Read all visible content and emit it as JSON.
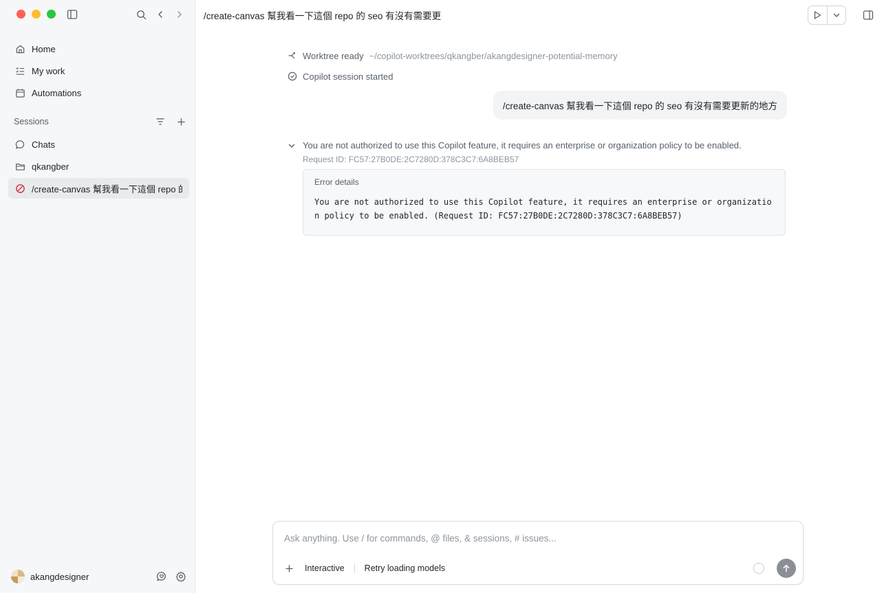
{
  "window": {
    "title": "/create-canvas 幫我看一下這個 repo 的 seo 有沒有需要更"
  },
  "sidebar": {
    "nav": [
      {
        "label": "Home",
        "icon": "home-icon"
      },
      {
        "label": "My work",
        "icon": "checklist-icon"
      },
      {
        "label": "Automations",
        "icon": "calendar-icon"
      }
    ],
    "sessions_label": "Sessions",
    "sessions": [
      {
        "label": "Chats",
        "icon": "chat-bubble-icon"
      },
      {
        "label": "qkangber",
        "icon": "folder-icon"
      },
      {
        "label": "/create-canvas 幫我看一下這個 repo 的 seo",
        "icon": "error-circle-icon",
        "active": true
      }
    ],
    "user": {
      "name": "akangdesigner"
    }
  },
  "events": {
    "worktree_label": "Worktree ready",
    "worktree_path": "~/copilot-worktrees/qkangber/akangdesigner-potential-memory",
    "session_started": "Copilot session started"
  },
  "user_message": "/create-canvas 幫我看一下這個 repo 的 seo 有沒有需要更新的地方",
  "error": {
    "summary": "You are not authorized to use this Copilot feature, it requires an enterprise or organization policy to be enabled.",
    "request_id": "Request ID: FC57:27B0DE:2C7280D:378C3C7:6A8BEB57",
    "details_title": "Error details",
    "details_message": "You are not authorized to use this Copilot feature, it requires an enterprise or organization policy to be enabled. (Request ID: FC57:27B0DE:2C7280D:378C3C7:6A8BEB57)"
  },
  "composer": {
    "placeholder": "Ask anything. Use / for commands, @ files, & sessions, # issues...",
    "mode": "Interactive",
    "model_status": "Retry loading models"
  },
  "colors": {
    "sidebar_bg": "#f6f7f8",
    "active_item": "#e8eaed",
    "error_red": "#d1242f",
    "send_button": "#8b8f95"
  }
}
